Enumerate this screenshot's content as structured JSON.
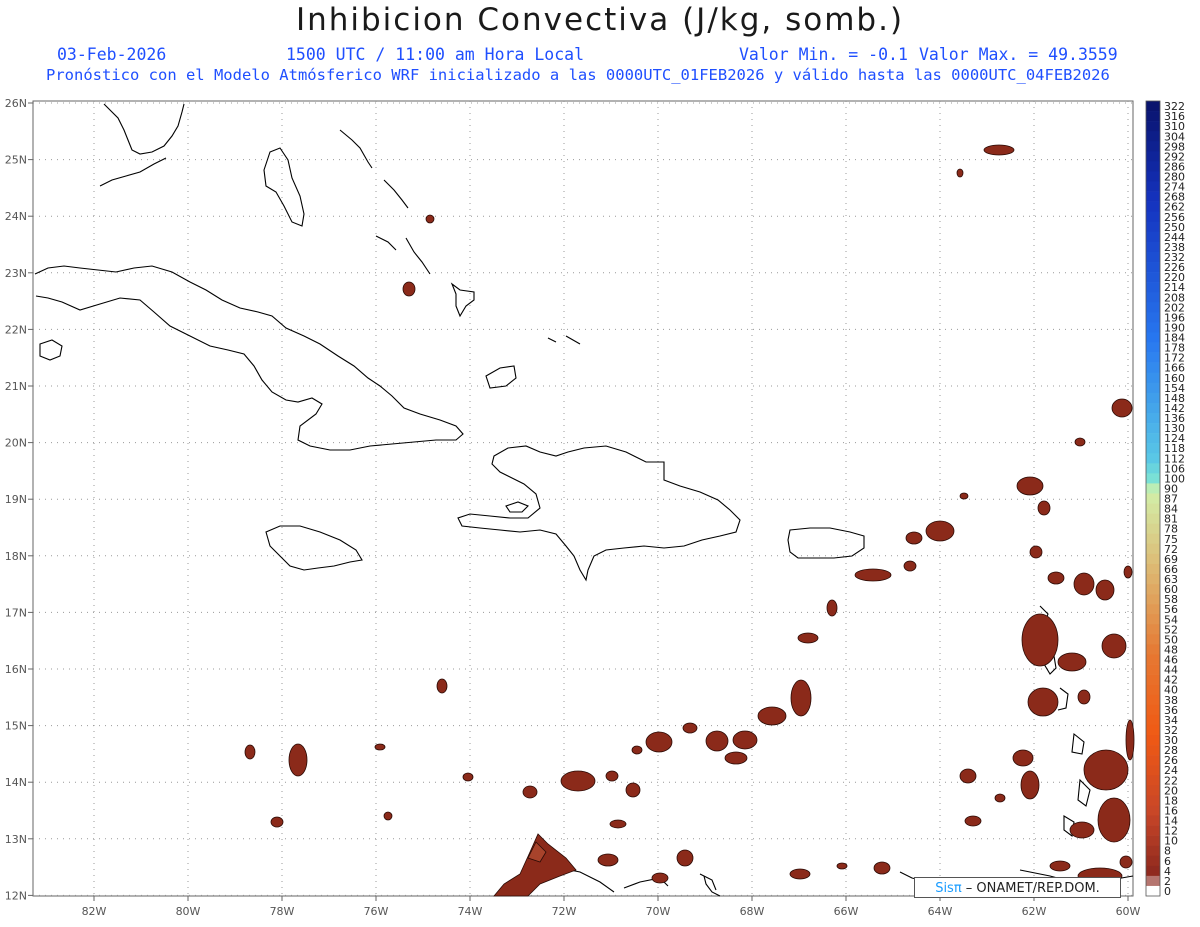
{
  "header": {
    "title": "Inhibicion Convectiva (J/kg, somb.)",
    "date": "03-Feb-2026",
    "time": "1500 UTC / 11:00 am Hora Local",
    "min_label": "Valor Min. = -0.1",
    "max_label": "Valor Max. = 49.3559",
    "forecast": "Pronóstico con el Modelo Atmósferico WRF inicializado a las 0000UTC_01FEB2026 y válido hasta las  0000UTC_04FEB2026"
  },
  "axes": {
    "lon_labels": [
      "82W",
      "80W",
      "78W",
      "76W",
      "74W",
      "72W",
      "70W",
      "68W",
      "66W",
      "64W",
      "62W",
      "60W"
    ],
    "lat_labels": [
      "26N",
      "25N",
      "24N",
      "23N",
      "22N",
      "21N",
      "20N",
      "19N",
      "18N",
      "17N",
      "16N",
      "15N",
      "14N",
      "13N",
      "12N"
    ]
  },
  "colorbar": {
    "labels": [
      "322",
      "316",
      "310",
      "304",
      "298",
      "292",
      "286",
      "280",
      "274",
      "268",
      "262",
      "256",
      "250",
      "244",
      "238",
      "232",
      "226",
      "220",
      "214",
      "208",
      "202",
      "196",
      "190",
      "184",
      "178",
      "172",
      "166",
      "160",
      "154",
      "148",
      "142",
      "136",
      "130",
      "124",
      "118",
      "112",
      "106",
      "100",
      "90",
      "87",
      "84",
      "81",
      "78",
      "75",
      "72",
      "69",
      "66",
      "63",
      "60",
      "58",
      "56",
      "54",
      "52",
      "50",
      "48",
      "46",
      "44",
      "42",
      "40",
      "38",
      "36",
      "34",
      "32",
      "30",
      "28",
      "26",
      "24",
      "22",
      "20",
      "18",
      "16",
      "14",
      "12",
      "10",
      "8",
      "6",
      "4",
      "2",
      "0"
    ]
  },
  "colors": {
    "field": "#8b2a1a",
    "field_light": "#a8432b",
    "subtitle": "#1f4fff"
  },
  "credit": {
    "sis": "Sisπ",
    "org": " – ONAMET/REP.DOM."
  }
}
